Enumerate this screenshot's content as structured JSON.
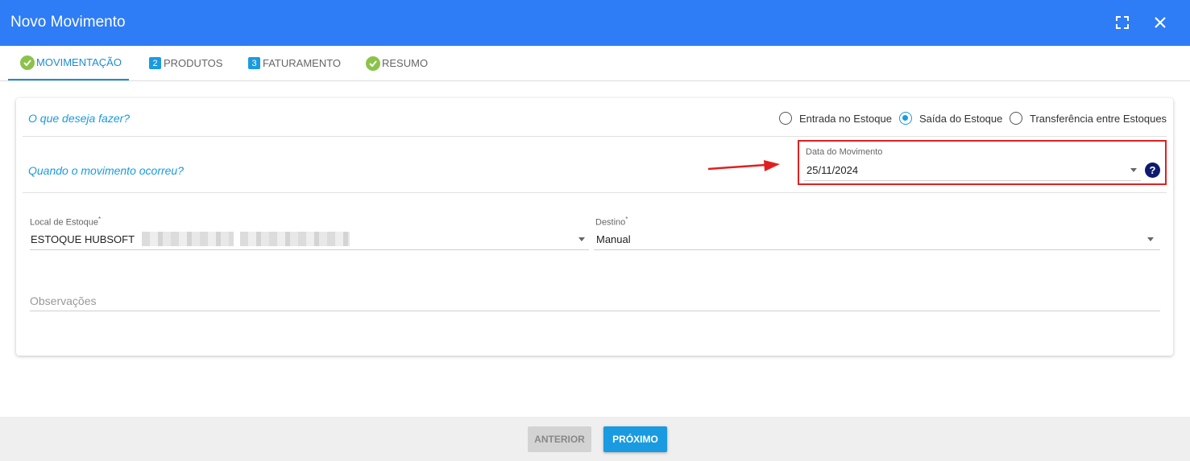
{
  "dialog": {
    "title": "Novo Movimento"
  },
  "tabs": [
    {
      "label": "MOVIMENTAÇÃO",
      "badge": "check",
      "active": true
    },
    {
      "label": "PRODUTOS",
      "badge": "2"
    },
    {
      "label": "FATURAMENTO",
      "badge": "3"
    },
    {
      "label": "RESUMO",
      "badge": "check"
    }
  ],
  "form": {
    "question_what": "O que deseja fazer?",
    "radio_options": [
      "Entrada no Estoque",
      "Saída do Estoque",
      "Transferência entre Estoques"
    ],
    "selected_option": "Saída do Estoque",
    "question_when": "Quando o movimento ocorreu?",
    "date_label": "Data do Movimento",
    "date_value": "25/11/2024",
    "help_symbol": "?",
    "local_label": "Local de Estoque",
    "local_value": "ESTOQUE HUBSOFT",
    "destino_label": "Destino",
    "destino_value": "Manual",
    "required_mark": "*",
    "observacoes_placeholder": "Observações"
  },
  "footer": {
    "prev_label": "ANTERIOR",
    "next_label": "PRÓXIMO"
  },
  "colors": {
    "header": "#2e7cf6",
    "accent": "#1a9ae0",
    "check": "#8bc34a",
    "highlight": "#e02020"
  }
}
